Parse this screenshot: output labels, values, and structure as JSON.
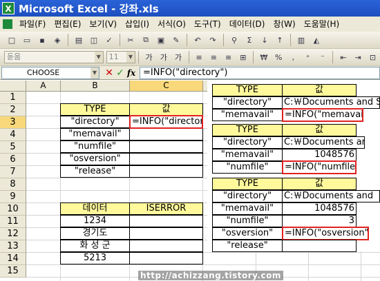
{
  "window": {
    "title": "Microsoft Excel - 강좌.xls",
    "app_icon": "X"
  },
  "menu": [
    "파일(F)",
    "편집(E)",
    "보기(V)",
    "삽입(I)",
    "서식(O)",
    "도구(T)",
    "데이터(D)",
    "창(W)",
    "도움말(H)"
  ],
  "format_bar": {
    "font_name": "돋움",
    "font_size": "11"
  },
  "formula_bar": {
    "name_box": "CHOOSE",
    "formula": "=INFO(\"directory\")",
    "fx_label": "fx"
  },
  "columns": [
    "A",
    "B",
    "C"
  ],
  "rows": [
    "1",
    "2",
    "3",
    "4",
    "5",
    "6",
    "7",
    "8",
    "9",
    "10",
    "11",
    "12",
    "13",
    "14",
    "15"
  ],
  "sheet": {
    "type_header": "TYPE",
    "value_header": "값",
    "types": [
      "\"directory\"",
      "\"memavail\"",
      "\"numfile\"",
      "\"osversion\"",
      "\"release\""
    ],
    "editing_formula": "=INFO(\"directory",
    "data_header": "데이터",
    "iserror_header": "ISERROR",
    "data_values": [
      "1234",
      "경기도",
      "화 성 군",
      "5213"
    ]
  },
  "overlay1": {
    "type_header": "TYPE",
    "value_header": "값",
    "rows": [
      {
        "type": "\"directory\"",
        "value": "C:￦Documents and S"
      },
      {
        "type": "\"memavail\"",
        "value": "=INFO(\"memavail\")"
      }
    ]
  },
  "overlay2": {
    "type_header": "TYPE",
    "value_header": "값",
    "rows": [
      {
        "type": "\"directory\"",
        "value": "C:￦Documents ar"
      },
      {
        "type": "\"memavail\"",
        "value": "1048576"
      },
      {
        "type": "\"numfile\"",
        "value": "=INFO(\"numfile\")"
      }
    ]
  },
  "overlay3": {
    "type_header": "TYPE",
    "value_header": "값",
    "rows": [
      {
        "type": "\"directory\"",
        "value": "C:￦Documents and"
      },
      {
        "type": "\"memavail\"",
        "value": "1048576"
      },
      {
        "type": "\"numfile\"",
        "value": "3"
      },
      {
        "type": "\"osversion\"",
        "value": "=INFO(\"osversion\")"
      },
      {
        "type": "\"release\"",
        "value": ""
      }
    ]
  },
  "watermark": "http://achizzang.tistory.com",
  "colors": {
    "header_yellow": "#fff99c",
    "active_header": "#f8d87a",
    "highlight_red": "#e02020",
    "title_blue": "#2a63d8"
  }
}
